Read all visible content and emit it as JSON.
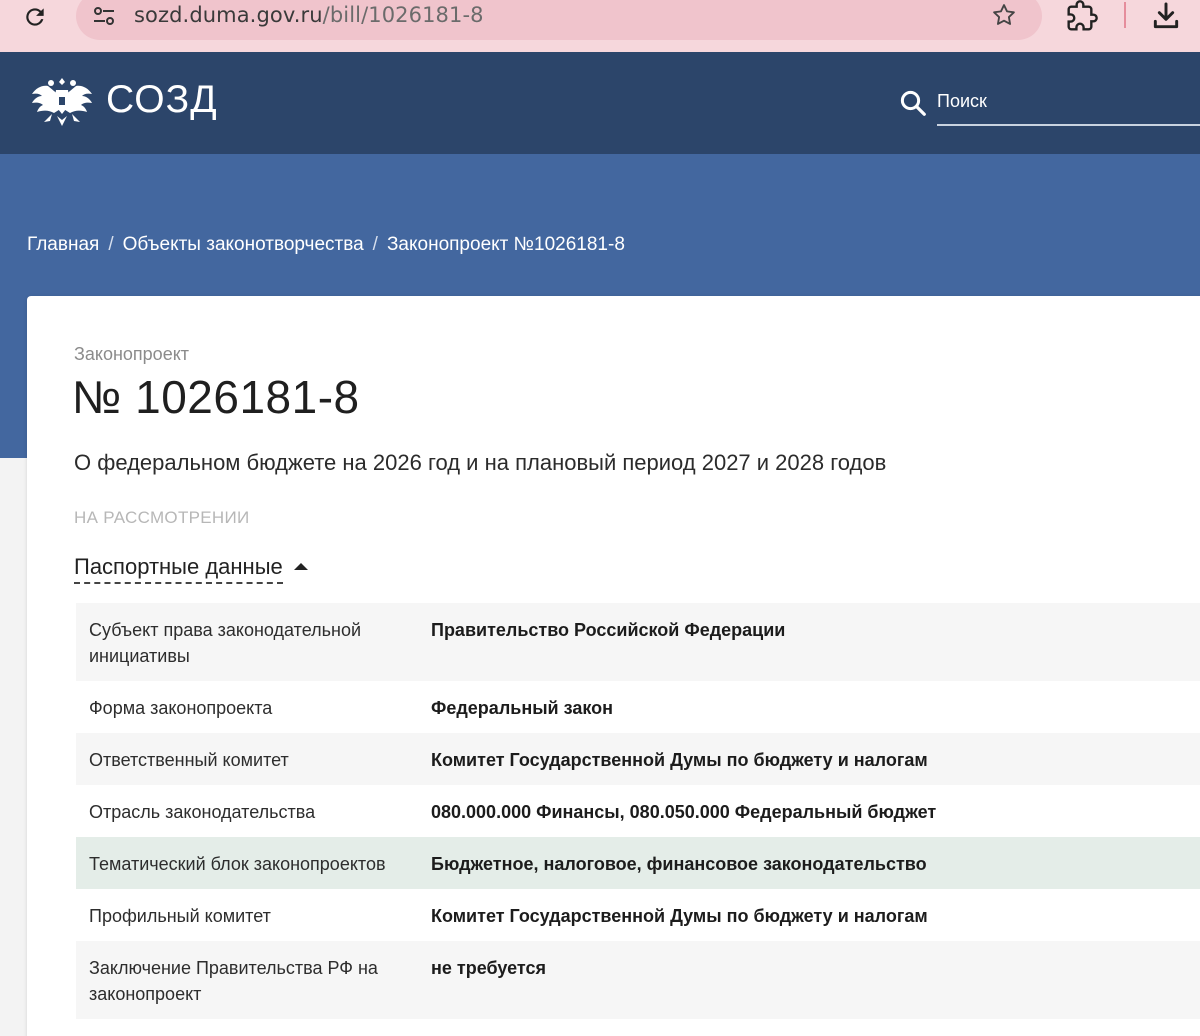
{
  "browser": {
    "url_host": "sozd.duma.gov.ru",
    "url_path": "/bill/1026181-8"
  },
  "site": {
    "logo_text": "СОЗД",
    "search_placeholder": "Поиск"
  },
  "breadcrumb": {
    "items": [
      "Главная",
      "Объекты законотворчества",
      "Законопроект №1026181-8"
    ]
  },
  "bill": {
    "kind": "Законопроект",
    "number": "№ 1026181-8",
    "title": "О федеральном бюджете на 2026 год и на плановый период 2027 и 2028 годов",
    "status": "НА РАССМОТРЕНИИ"
  },
  "passport": {
    "section_label": "Паспортные данные",
    "rows": [
      {
        "label": "Субъект права законодательной инициативы",
        "value": "Правительство Российской Федерации"
      },
      {
        "label": "Форма законопроекта",
        "value": "Федеральный закон"
      },
      {
        "label": "Ответственный комитет",
        "value": "Комитет Государственной Думы по бюджету и налогам"
      },
      {
        "label": "Отрасль законодательства",
        "value": "080.000.000 Финансы, 080.050.000 Федеральный бюджет"
      },
      {
        "label": "Тематический блок законопроектов",
        "value": "Бюджетное, налоговое, финансовое законодательство"
      },
      {
        "label": "Профильный комитет",
        "value": "Комитет Государственной Думы по бюджету и налогам"
      },
      {
        "label": "Заключение Правительства РФ на законопроект",
        "value": "не требуется"
      }
    ]
  },
  "colors": {
    "header_bg": "#2c456a",
    "hero_bg": "#43679f",
    "browser_bar": "#f6d7dc",
    "row_highlight": "#e4ede8"
  }
}
